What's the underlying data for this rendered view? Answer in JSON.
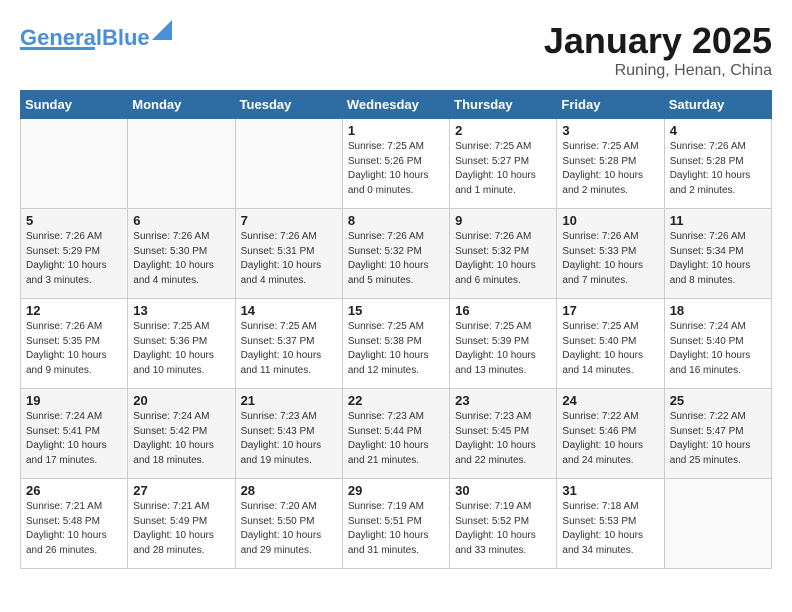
{
  "header": {
    "logo_line1": "General",
    "logo_line2": "Blue",
    "title": "January 2025",
    "location": "Runing, Henan, China"
  },
  "weekdays": [
    "Sunday",
    "Monday",
    "Tuesday",
    "Wednesday",
    "Thursday",
    "Friday",
    "Saturday"
  ],
  "weeks": [
    [
      {
        "day": "",
        "info": ""
      },
      {
        "day": "",
        "info": ""
      },
      {
        "day": "",
        "info": ""
      },
      {
        "day": "1",
        "info": "Sunrise: 7:25 AM\nSunset: 5:26 PM\nDaylight: 10 hours\nand 0 minutes."
      },
      {
        "day": "2",
        "info": "Sunrise: 7:25 AM\nSunset: 5:27 PM\nDaylight: 10 hours\nand 1 minute."
      },
      {
        "day": "3",
        "info": "Sunrise: 7:25 AM\nSunset: 5:28 PM\nDaylight: 10 hours\nand 2 minutes."
      },
      {
        "day": "4",
        "info": "Sunrise: 7:26 AM\nSunset: 5:28 PM\nDaylight: 10 hours\nand 2 minutes."
      }
    ],
    [
      {
        "day": "5",
        "info": "Sunrise: 7:26 AM\nSunset: 5:29 PM\nDaylight: 10 hours\nand 3 minutes."
      },
      {
        "day": "6",
        "info": "Sunrise: 7:26 AM\nSunset: 5:30 PM\nDaylight: 10 hours\nand 4 minutes."
      },
      {
        "day": "7",
        "info": "Sunrise: 7:26 AM\nSunset: 5:31 PM\nDaylight: 10 hours\nand 4 minutes."
      },
      {
        "day": "8",
        "info": "Sunrise: 7:26 AM\nSunset: 5:32 PM\nDaylight: 10 hours\nand 5 minutes."
      },
      {
        "day": "9",
        "info": "Sunrise: 7:26 AM\nSunset: 5:32 PM\nDaylight: 10 hours\nand 6 minutes."
      },
      {
        "day": "10",
        "info": "Sunrise: 7:26 AM\nSunset: 5:33 PM\nDaylight: 10 hours\nand 7 minutes."
      },
      {
        "day": "11",
        "info": "Sunrise: 7:26 AM\nSunset: 5:34 PM\nDaylight: 10 hours\nand 8 minutes."
      }
    ],
    [
      {
        "day": "12",
        "info": "Sunrise: 7:26 AM\nSunset: 5:35 PM\nDaylight: 10 hours\nand 9 minutes."
      },
      {
        "day": "13",
        "info": "Sunrise: 7:25 AM\nSunset: 5:36 PM\nDaylight: 10 hours\nand 10 minutes."
      },
      {
        "day": "14",
        "info": "Sunrise: 7:25 AM\nSunset: 5:37 PM\nDaylight: 10 hours\nand 11 minutes."
      },
      {
        "day": "15",
        "info": "Sunrise: 7:25 AM\nSunset: 5:38 PM\nDaylight: 10 hours\nand 12 minutes."
      },
      {
        "day": "16",
        "info": "Sunrise: 7:25 AM\nSunset: 5:39 PM\nDaylight: 10 hours\nand 13 minutes."
      },
      {
        "day": "17",
        "info": "Sunrise: 7:25 AM\nSunset: 5:40 PM\nDaylight: 10 hours\nand 14 minutes."
      },
      {
        "day": "18",
        "info": "Sunrise: 7:24 AM\nSunset: 5:40 PM\nDaylight: 10 hours\nand 16 minutes."
      }
    ],
    [
      {
        "day": "19",
        "info": "Sunrise: 7:24 AM\nSunset: 5:41 PM\nDaylight: 10 hours\nand 17 minutes."
      },
      {
        "day": "20",
        "info": "Sunrise: 7:24 AM\nSunset: 5:42 PM\nDaylight: 10 hours\nand 18 minutes."
      },
      {
        "day": "21",
        "info": "Sunrise: 7:23 AM\nSunset: 5:43 PM\nDaylight: 10 hours\nand 19 minutes."
      },
      {
        "day": "22",
        "info": "Sunrise: 7:23 AM\nSunset: 5:44 PM\nDaylight: 10 hours\nand 21 minutes."
      },
      {
        "day": "23",
        "info": "Sunrise: 7:23 AM\nSunset: 5:45 PM\nDaylight: 10 hours\nand 22 minutes."
      },
      {
        "day": "24",
        "info": "Sunrise: 7:22 AM\nSunset: 5:46 PM\nDaylight: 10 hours\nand 24 minutes."
      },
      {
        "day": "25",
        "info": "Sunrise: 7:22 AM\nSunset: 5:47 PM\nDaylight: 10 hours\nand 25 minutes."
      }
    ],
    [
      {
        "day": "26",
        "info": "Sunrise: 7:21 AM\nSunset: 5:48 PM\nDaylight: 10 hours\nand 26 minutes."
      },
      {
        "day": "27",
        "info": "Sunrise: 7:21 AM\nSunset: 5:49 PM\nDaylight: 10 hours\nand 28 minutes."
      },
      {
        "day": "28",
        "info": "Sunrise: 7:20 AM\nSunset: 5:50 PM\nDaylight: 10 hours\nand 29 minutes."
      },
      {
        "day": "29",
        "info": "Sunrise: 7:19 AM\nSunset: 5:51 PM\nDaylight: 10 hours\nand 31 minutes."
      },
      {
        "day": "30",
        "info": "Sunrise: 7:19 AM\nSunset: 5:52 PM\nDaylight: 10 hours\nand 33 minutes."
      },
      {
        "day": "31",
        "info": "Sunrise: 7:18 AM\nSunset: 5:53 PM\nDaylight: 10 hours\nand 34 minutes."
      },
      {
        "day": "",
        "info": ""
      }
    ]
  ]
}
